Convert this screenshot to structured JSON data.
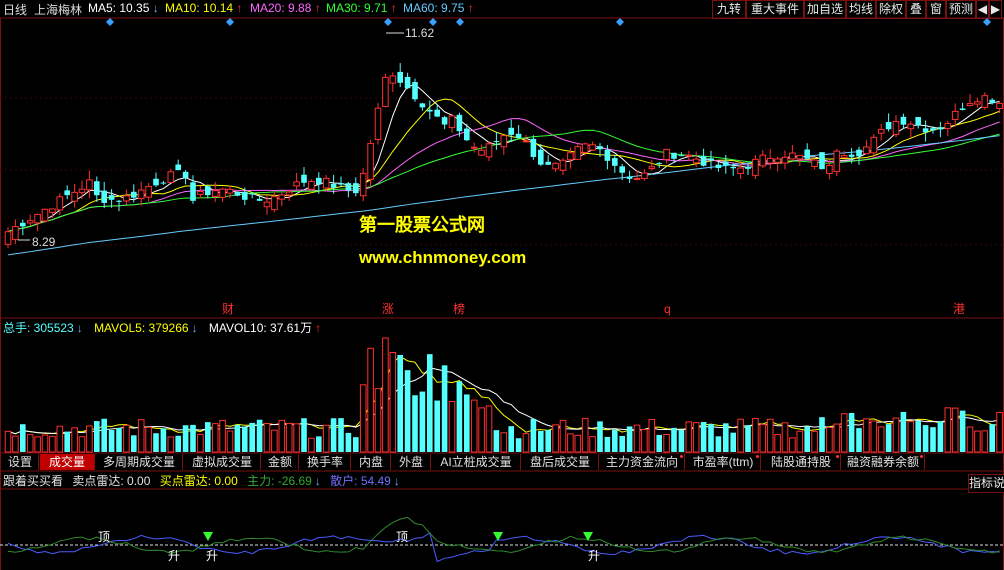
{
  "topbar": {
    "period": "日线",
    "stock_name": "上海梅林",
    "ma": [
      {
        "label": "MA5: 10.35",
        "arrow": "↓",
        "color": "#ffffff"
      },
      {
        "label": "MA10: 10.14",
        "arrow": "↑",
        "color": "#ffff00"
      },
      {
        "label": "MA20: 9.88",
        "arrow": "↑",
        "color": "#ff66ff"
      },
      {
        "label": "MA30: 9.71",
        "arrow": "↑",
        "color": "#33ff33"
      },
      {
        "label": "MA60: 9.75",
        "arrow": "↑",
        "color": "#66ccff"
      }
    ],
    "buttons": [
      "九转",
      "重大事件",
      "加自选",
      "均线",
      "除权",
      "叠",
      "窗",
      "预测"
    ]
  },
  "main_chart": {
    "high_label": "11.62",
    "low_label": "8.29",
    "watermark_title": "第一股票公式网",
    "watermark_url": "www.chnmoney.com",
    "event_markers": [
      "财",
      "涨",
      "榜",
      "q",
      "港"
    ]
  },
  "volume_panel": {
    "total_label": "总手: 305523",
    "total_arrow": "↓",
    "mavol5_label": "MAVOL5: 379266",
    "mavol5_arrow": "↓",
    "mavol10_label": "MAVOL10: 37.61万",
    "mavol10_arrow": "↑"
  },
  "tabs": [
    "设置",
    "成交量",
    "多周期成交量",
    "虚拟成交量",
    "金额",
    "换手率",
    "内盘",
    "外盘",
    "AI立桩成交量",
    "盘后成交量",
    "主力资金流向",
    "市盈率(ttm)",
    "陆股通持股",
    "融资融券余额"
  ],
  "indicator_panel": {
    "name": "跟着买买看",
    "sell_label": "卖点雷达: 0.00",
    "buy_label": "买点雷达: 0.00",
    "main_force_label": "主力: -26.69",
    "main_force_arrow": "↓",
    "retail_label": "散户: 54.49",
    "retail_arrow": "↓",
    "right_button": "指标说",
    "markers": [
      "顶",
      "升",
      "升",
      "顶",
      "升"
    ]
  },
  "colors": {
    "up": "#ff3030",
    "down": "#54ffff",
    "ma5": "#ffffff",
    "ma10": "#ffff00",
    "ma20": "#ff66ff",
    "ma30": "#33ff33",
    "ma60": "#66ccff",
    "frame": "#7a1010",
    "watermark_title": "#ffff00",
    "watermark_url": "#ffff00"
  },
  "chart_data": {
    "type": "line",
    "candles_count": 135,
    "price_high": 11.62,
    "price_low": 8.29,
    "ma_values_last": {
      "MA5": 10.35,
      "MA10": 10.14,
      "MA20": 9.88,
      "MA30": 9.71,
      "MA60": 9.75
    },
    "volume_last": 305523,
    "mavol5_last": 379266,
    "mavol10_last": 376100,
    "main_force_last": -26.69,
    "retail_last": 54.49
  }
}
